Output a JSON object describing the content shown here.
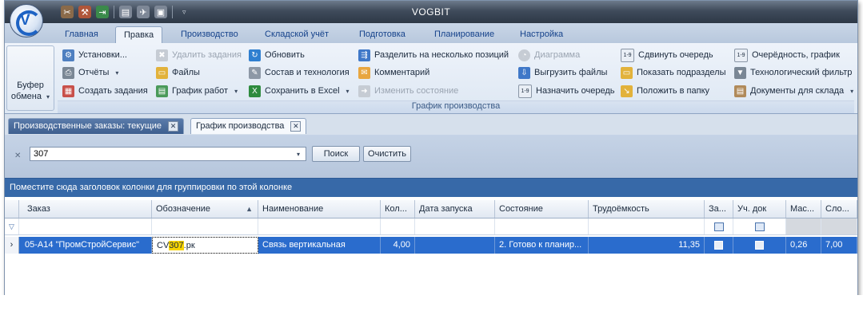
{
  "app": {
    "title": "VOGBIT"
  },
  "qat": {
    "icons": [
      "tools-icon",
      "hammer-icon",
      "exit-icon",
      "document-icon",
      "plane-icon",
      "image-icon"
    ]
  },
  "ribbon_tabs": [
    "Главная",
    "Правка",
    "Производство",
    "Складской учёт",
    "Подготовка",
    "Планирование",
    "Настройка"
  ],
  "ribbon_active_tab": "Правка",
  "clipboard": {
    "line1": "Буфер",
    "line2": "обмена"
  },
  "ribbon": {
    "ustanovki": "Установки...",
    "otchety": "Отчёты",
    "sozdat_zadaniya": "Создать задания",
    "udalit_zadaniya": "Удалить задания",
    "faily": "Файлы",
    "grafik_rabot": "График работ",
    "obnovit": "Обновить",
    "sostav": "Состав и технология",
    "sohranit_excel": "Сохранить в Excel",
    "razdelit": "Разделить на несколько позиций",
    "kommentariy": "Комментарий",
    "izmenit_sostoyanie": "Изменить состояние",
    "diagramma": "Диаграмма",
    "vygruzit_faily": "Выгрузить файлы",
    "naznachit_ochered": "Назначить очередь",
    "sdvinut_ochered": "Сдвинуть очередь",
    "pokazat_podrazdely": "Показать подразделы",
    "polozhit_v_papku": "Положить в папку",
    "ocherednost_grafik": "Очерёдность, график",
    "tech_filtr": "Технологический фильтр",
    "dokumenty_sklad": "Документы для склада",
    "group_caption": "График производства",
    "badge_19": "1-9"
  },
  "doc_tabs": {
    "tab1": "Производственные заказы: текущие",
    "tab2": "График производства"
  },
  "search": {
    "value": "307",
    "search_btn": "Поиск",
    "clear_btn": "Очистить"
  },
  "group_panel": "Поместите сюда заголовок колонки для группировки по этой колонке",
  "columns": {
    "zakaz": "Заказ",
    "oboznachenie": "Обозначение",
    "naimenovanie": "Наименование",
    "kol": "Кол...",
    "data_zapuska": "Дата запуска",
    "sostoyanie": "Состояние",
    "trudoemkost": "Трудоёмкость",
    "za": "За...",
    "uch_dok": "Уч. док",
    "mas": "Мас...",
    "slo": "Сло..."
  },
  "row": {
    "zakaz": "05-А14 \"ПромСтройСервис\"",
    "obozn_prefix": "CV",
    "obozn_match": "307",
    "obozn_suffix": ".рк",
    "naimenovanie": "Связь вертикальная",
    "kol": "4,00",
    "data_zapuska": "",
    "sostoyanie": "2. Готово к планир...",
    "trudoemkost": "11,35",
    "mas": "0,26",
    "slo": "7,00"
  },
  "colors": {
    "selection": "#2a6ccd",
    "group_panel": "#3769a8",
    "highlight": "#f7d300"
  }
}
